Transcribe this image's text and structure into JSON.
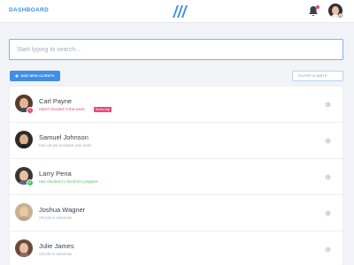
{
  "header": {
    "title": "DASHBOARD",
    "logo_icon": "triple-slash-logo-icon",
    "notifications_icon": "bell-icon",
    "notification_color": "#e8457a",
    "accent_color": "#3d8fe6"
  },
  "search": {
    "placeholder": "Start typing to search...",
    "value": ""
  },
  "toolbar": {
    "add_label": "ADD NEW CLIENTS",
    "add_icon": "plus-icon",
    "filter_label": "FILTER CLIENTS"
  },
  "clients": [
    {
      "name": "Carl Payne",
      "status_text": "Hasn't checked in this week",
      "badge": "Needs help",
      "status": "alert",
      "status_color": "#e8457a",
      "settings_icon": "gear-icon"
    },
    {
      "name": "Samuel Johnson",
      "status_text": "Has not yet accepted your invite",
      "badge": "",
      "status": "pending",
      "status_color": "#a2a9b4",
      "settings_icon": "gear-icon"
    },
    {
      "name": "Larry Pena",
      "status_text": "Has checked in! check her progress",
      "badge": "",
      "status": "success",
      "status_color": "#4cc25a",
      "settings_icon": "gear-icon"
    },
    {
      "name": "Joshua Wagner",
      "status_text": "Checks in tomorrow",
      "badge": "",
      "status": "upcoming",
      "status_color": "#a2a9b4",
      "settings_icon": "gear-icon"
    },
    {
      "name": "Julie James",
      "status_text": "Checks in tomorrow",
      "badge": "",
      "status": "upcoming",
      "status_color": "#a2a9b4",
      "settings_icon": "gear-icon"
    }
  ]
}
